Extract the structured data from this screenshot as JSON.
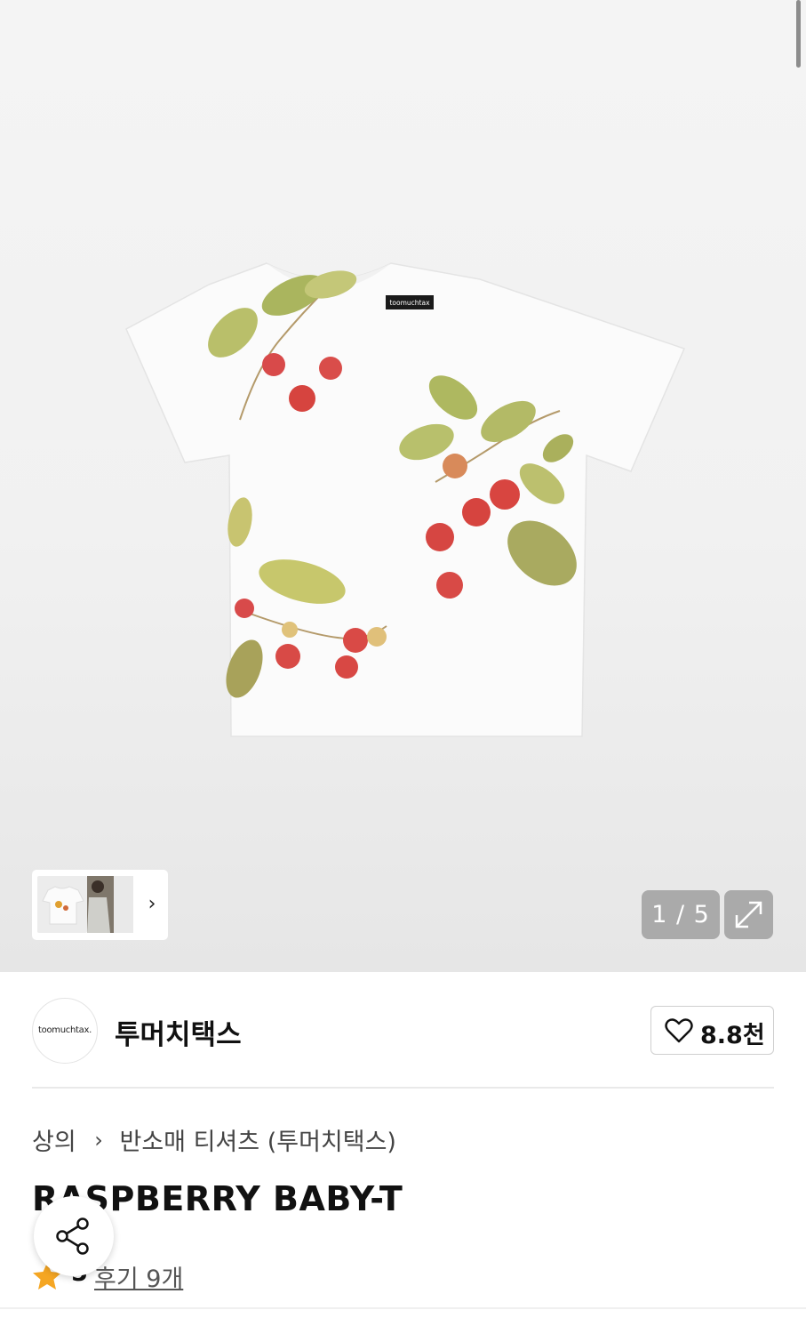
{
  "gallery": {
    "shirt_tag": "toomuchtax",
    "counter": "1 / 5"
  },
  "brand": {
    "logo_text": "toomuchtax.",
    "name": "투머치택스",
    "likes": "8.8천"
  },
  "breadcrumb": {
    "category": "상의",
    "subcategory": "반소매 티셔츠 (투머치택스)"
  },
  "product": {
    "title": "RASPBERRY BABY-T"
  },
  "rating": {
    "score": "5",
    "reviews": "후기 9개"
  },
  "colors": {
    "star": "#F5A623",
    "berry": "#d84a4a",
    "leaf": "#b9bf6a"
  }
}
